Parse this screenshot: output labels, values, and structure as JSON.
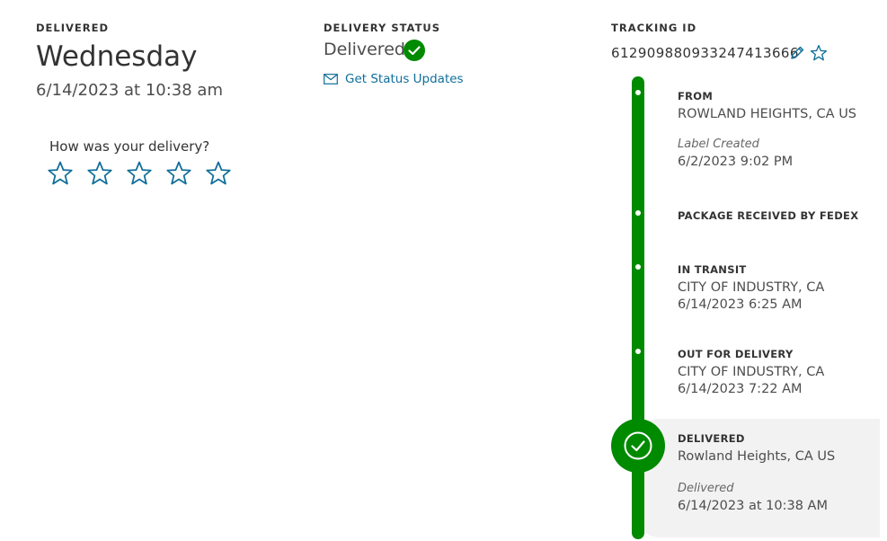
{
  "delivered_col": {
    "label": "DELIVERED",
    "day": "Wednesday",
    "datetime": "6/14/2023 at 10:38 am"
  },
  "rating": {
    "prompt": "How was your delivery?",
    "star_count": 5,
    "selected": 0
  },
  "status_col": {
    "label": "DELIVERY STATUS",
    "status": "Delivered",
    "updates_link": "Get Status Updates"
  },
  "tracking_col": {
    "label": "TRACKING ID",
    "id": "612909880933247413666"
  },
  "timeline": {
    "from": {
      "title": "FROM",
      "location": "ROWLAND HEIGHTS, CA US",
      "event": "Label Created",
      "datetime": "6/2/2023 9:02 PM"
    },
    "received": {
      "title": "PACKAGE RECEIVED BY FEDEX"
    },
    "in_transit": {
      "title": "IN TRANSIT",
      "location": "CITY OF INDUSTRY, CA",
      "datetime": "6/14/2023 6:25 AM"
    },
    "out_for_delivery": {
      "title": "OUT FOR DELIVERY",
      "location": "CITY OF INDUSTRY, CA",
      "datetime": "6/14/2023 7:22 AM"
    },
    "delivered": {
      "title": "DELIVERED",
      "location": "Rowland Heights, CA US",
      "event": "Delivered",
      "datetime": "6/14/2023 at 10:38 AM"
    }
  },
  "colors": {
    "success_green": "#008a00",
    "link_blue": "#0f6e99",
    "card_gray": "#f2f2f2"
  },
  "icons": {
    "status": "check-circle-icon",
    "updates": "envelope-icon",
    "edit": "pencil-icon",
    "favorite": "star-outline-icon",
    "rating": "star-outline-icon"
  }
}
